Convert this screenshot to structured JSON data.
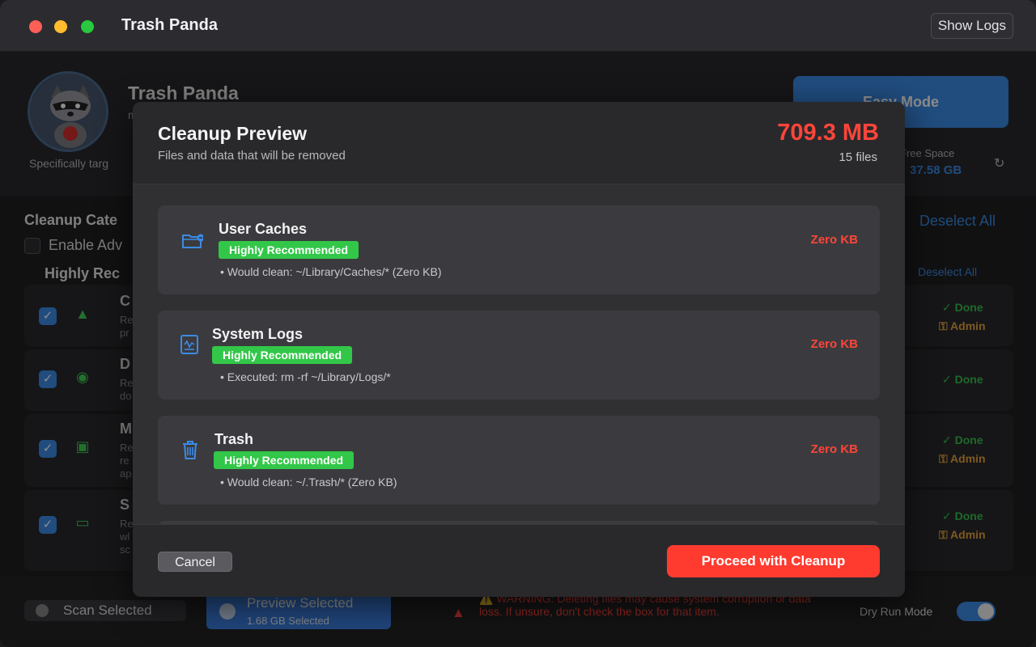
{
  "window": {
    "title": "Trash Panda",
    "show_logs_label": "Show Logs"
  },
  "hero": {
    "title": "Trash Panda",
    "subtitle": "m",
    "description": "Specifically targ",
    "easy_mode_label": "Easy Mode",
    "free_space_label": "Free Space",
    "free_space_value": "37.58 GB",
    "refresh_icon": "refresh-icon"
  },
  "categories": {
    "title": "Cleanup Cate",
    "deselect_all": "Deselect All",
    "enable_advanced": "Enable Adv",
    "highly_recommended_title": "Highly Rec",
    "section_deselect_all": "Deselect All",
    "rows": [
      {
        "letter": "C",
        "lines": [
          "Re",
          "pr"
        ],
        "icon": "warning-icon",
        "status": "Done",
        "admin": "Admin"
      },
      {
        "letter": "D",
        "lines": [
          "Re",
          "do"
        ],
        "icon": "chat-icon",
        "status": "Done",
        "admin": ""
      },
      {
        "letter": "M",
        "lines": [
          "Re",
          "re",
          "ap"
        ],
        "icon": "chip-icon",
        "status": "Done",
        "admin": "Admin"
      },
      {
        "letter": "S",
        "lines": [
          "Re",
          "wl",
          "sc"
        ],
        "icon": "display-icon",
        "status": "Done",
        "admin": "Admin"
      }
    ]
  },
  "bottom": {
    "scan_selected": "Scan Selected",
    "preview_selected": "Preview Selected",
    "selected_size": "1.68 GB Selected",
    "warning": "⚠️ WARNING: Deleting files may cause system corruption or data loss. If unsure, don't check the box for that item.",
    "dry_run_label": "Dry Run Mode",
    "dry_run_enabled": true
  },
  "modal": {
    "title": "Cleanup Preview",
    "subtitle": "Files and data that will be removed",
    "total_size": "709.3 MB",
    "file_count": "15 files",
    "items": [
      {
        "name": "User Caches",
        "badge": "Highly Recommended",
        "detail": "• Would clean: ~/Library/Caches/* (Zero KB)",
        "size": "Zero KB",
        "icon": "folder-icon"
      },
      {
        "name": "System Logs",
        "badge": "Highly Recommended",
        "detail": "• Executed: rm -rf ~/Library/Logs/*",
        "size": "Zero KB",
        "icon": "log-icon"
      },
      {
        "name": "Trash",
        "badge": "Highly Recommended",
        "detail": "• Would clean: ~/.Trash/* (Zero KB)",
        "size": "Zero KB",
        "icon": "trash-icon"
      }
    ],
    "cancel_label": "Cancel",
    "proceed_label": "Proceed with Cleanup"
  },
  "colors": {
    "accent": "#3b8be5",
    "danger": "#ff453a",
    "success": "#32c748",
    "admin": "#e6a23c"
  }
}
